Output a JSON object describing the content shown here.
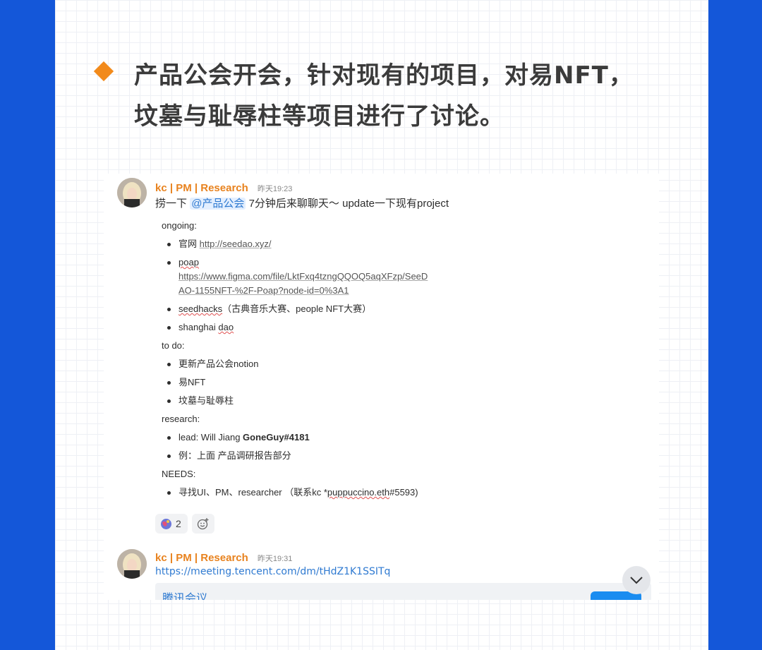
{
  "headline": {
    "line1": "产品公会开会，针对现有的项目，对易NFT，",
    "line2": "坟墓与耻辱柱等项目进行了讨论。"
  },
  "colors": {
    "background": "#1457d9",
    "accent": "#f28a1b",
    "author": "#e8821e",
    "link": "#2f7ad1"
  },
  "messages": [
    {
      "author": "kc | PM | Research",
      "time": "昨天19:23",
      "prefix": "捞一下",
      "mention": "@产品公会",
      "suffix": "7分钟后来聊聊天～ update一下现有project",
      "sections": {
        "ongoing": {
          "title": "ongoing:",
          "official_label": "官网",
          "official_link": "http://seedao.xyz/",
          "poap_label": "poap",
          "poap_link_1": "https://www.figma.com/file/LktFxq4tzngQQOQ5aqXFzp/SeeD",
          "poap_link_2": "AO-1155NFT-%2F-Poap?node-id=0%3A1",
          "seedhacks_label": "seedhacks",
          "seedhacks_note": "（古典音乐大赛、people NFT大赛）",
          "shanghai_1": "shanghai ",
          "shanghai_2": "dao"
        },
        "todo": {
          "title": "to do:",
          "items": [
            "更新产品公会notion",
            "易NFT",
            "坟墓与耻辱柱"
          ]
        },
        "research": {
          "title": "research:",
          "lead_label": "lead: Will Jiang ",
          "lead_name": "GoneGuy#4181",
          "example": "例：上面 产品调研报告部分"
        },
        "needs": {
          "title": "NEEDS:",
          "item_prefix": "寻找UI、PM、researcher （联系kc *",
          "item_handle": "puppuccino.eth",
          "item_suffix": "#5593)"
        }
      },
      "reactions": {
        "count": "2"
      }
    },
    {
      "author": "kc | PM | Research",
      "time": "昨天19:31",
      "url": "https://meeting.tencent.com/dm/tHdZ1K1SSITq",
      "embed_title": "腾讯会议"
    }
  ]
}
